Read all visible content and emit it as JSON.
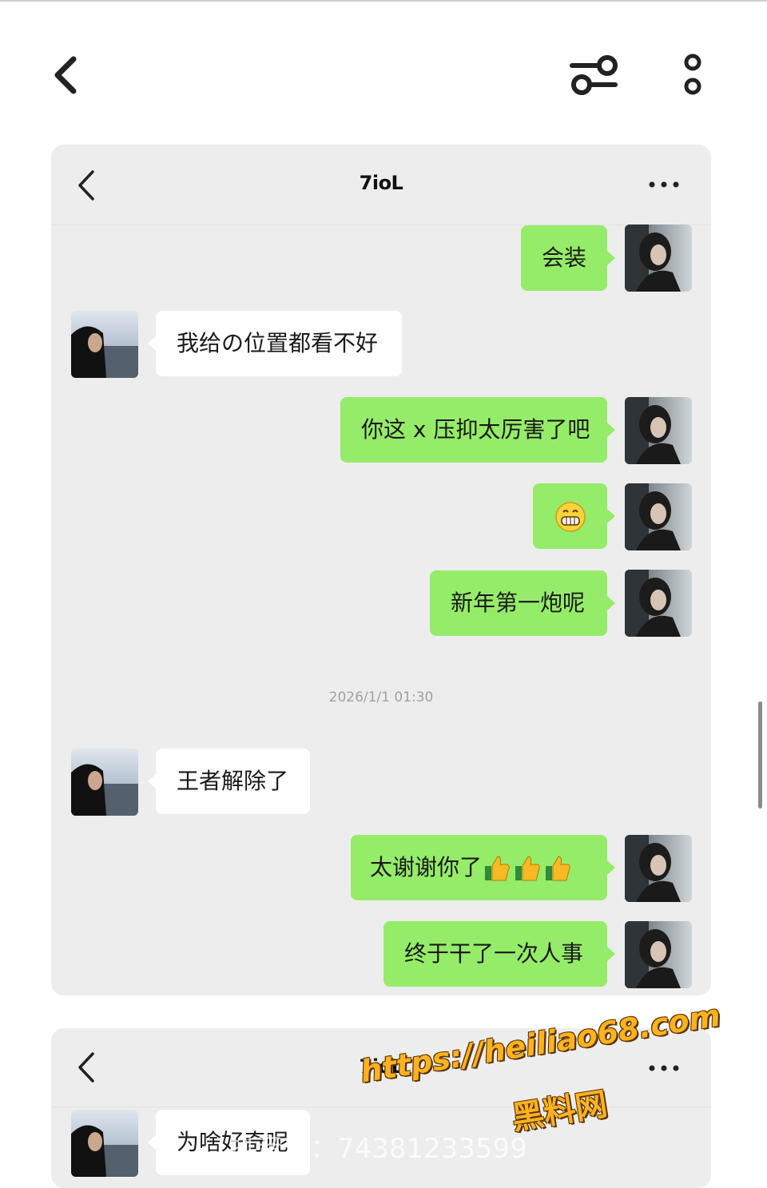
{
  "app": {
    "back_icon": "chevron-left-icon",
    "filter_icon": "sliders-icon",
    "more_icon": "vertical-dots-icon"
  },
  "chats": [
    {
      "contact_name": "7ioL",
      "messages": [
        {
          "from": "me",
          "text": "会装"
        },
        {
          "from": "them",
          "text": "我给の位置都看不好"
        },
        {
          "from": "me",
          "text": "你这 x 压抑太厉害了吧"
        },
        {
          "from": "me",
          "emoji": "grinning-face"
        },
        {
          "from": "me",
          "text": "新年第一炮呢"
        },
        {
          "type": "timestamp",
          "text": "2026/1/1 01:30"
        },
        {
          "from": "them",
          "text": "王者解除了"
        },
        {
          "from": "me",
          "text": "太谢谢你了",
          "emoji": "thumbs-up x3"
        },
        {
          "from": "me",
          "text": "终于干了一次人事"
        }
      ]
    },
    {
      "contact_name": "7ioL",
      "messages": [
        {
          "from": "them",
          "text": "为啥好奇呢"
        }
      ]
    }
  ],
  "watermarks": {
    "douyin_id": "抖音号：74381233599",
    "url": "https://heiliao68.com",
    "site_name": "黑料网"
  },
  "colors": {
    "my_bubble": "#95ec69",
    "their_bubble": "#ffffff",
    "chat_bg": "#ededed"
  }
}
